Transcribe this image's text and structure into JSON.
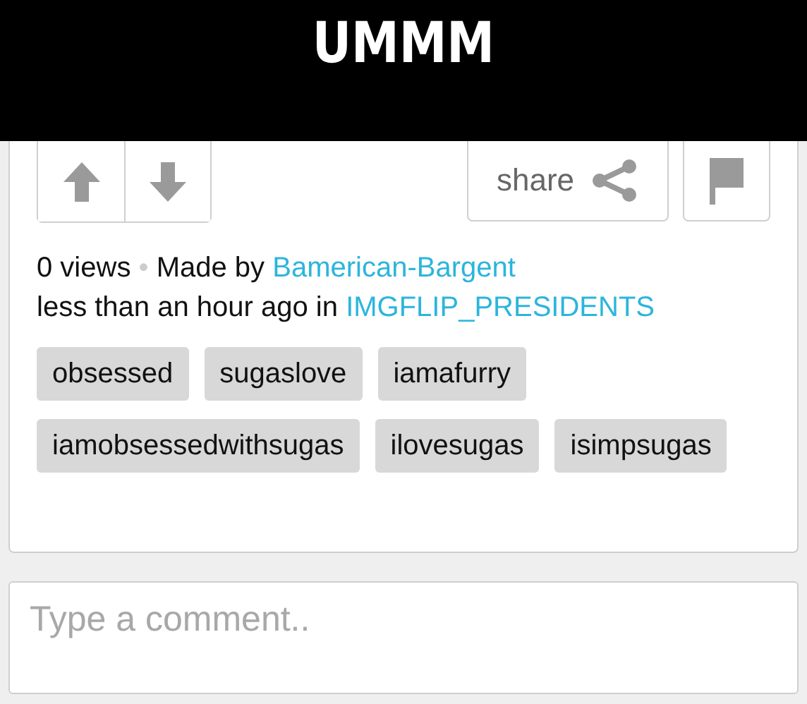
{
  "caption": "UMMM",
  "actions": {
    "share": "share"
  },
  "meta": {
    "views": "0 views",
    "separator": "•",
    "made_by": "Made by",
    "author": "Bamerican-Bargent",
    "time": "less than an hour ago in",
    "stream": "IMGFLIP_PRESIDENTS"
  },
  "tags": [
    "obsessed",
    "sugaslove",
    "iamafurry",
    "iamobsessedwithsugas",
    "ilovesugas",
    "isimpsugas"
  ],
  "comment": {
    "placeholder": "Type a comment.."
  }
}
